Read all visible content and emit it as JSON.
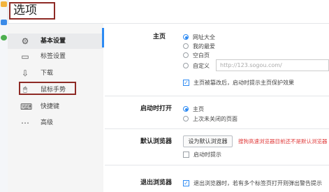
{
  "window": {
    "title": "选项"
  },
  "sidebar": {
    "items": [
      {
        "label": "基本设置",
        "icon": "gear-icon",
        "glyph": "⚙"
      },
      {
        "label": "标签设置",
        "icon": "tab-icon",
        "glyph": "▭"
      },
      {
        "label": "下载",
        "icon": "download-icon",
        "glyph": "⇩"
      },
      {
        "label": "鼠标手势",
        "icon": "mouse-icon",
        "glyph": "🖱"
      },
      {
        "label": "快捷键",
        "icon": "shortcut-icon",
        "glyph": "⌨"
      },
      {
        "label": "高级",
        "icon": "more-icon",
        "glyph": "⋯"
      }
    ]
  },
  "homepage": {
    "label": "主页",
    "options": [
      "网址大全",
      "我的最爱",
      "空白页",
      "自定义"
    ],
    "selected": "网址大全",
    "url_placeholder": "http://123.sogou.com/",
    "protect_label": "主页被篡改后，启动时提示主页保护效果",
    "protect_checked": true
  },
  "startup": {
    "label": "启动时打开",
    "options": [
      "主页",
      "上次未关闭的页面"
    ],
    "selected": "主页"
  },
  "default_browser": {
    "label": "默认浏览器",
    "button": "设为默认浏览器",
    "warning": "搜狗高速浏览器目前还不是默认浏览器",
    "startup_prompt": "启动时提示",
    "startup_prompt_checked": false
  },
  "exit_browser": {
    "label": "退出浏览器",
    "option": "退出浏览器时，若有多个标签页打开则弹出警告提示",
    "checked": true
  },
  "colors": {
    "accent": "#2c8af3",
    "highlight_border": "#8e2a25",
    "warning": "#e03b3b"
  }
}
